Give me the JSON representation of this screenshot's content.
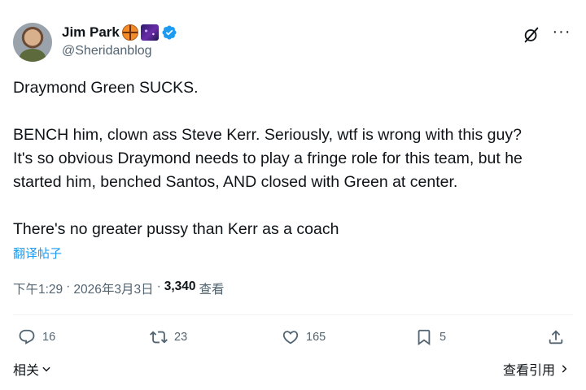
{
  "author": {
    "display_name": "Jim Park",
    "handle": "@Sheridanblog",
    "badges": [
      "basketball-emoji",
      "galaxy-emoji",
      "verified-badge"
    ]
  },
  "tweet": {
    "lines": [
      "Draymond Green SUCKS.",
      "",
      "BENCH him, clown ass Steve Kerr. Seriously, wtf is wrong with this guy?",
      "It's so obvious Draymond needs to play a fringe role for this team, but he",
      "started him, benched Santos, AND closed with Green at center.",
      "",
      "There's no greater pussy than Kerr as a coach"
    ],
    "translate_label": "翻译帖子"
  },
  "meta": {
    "time": "下午1:29",
    "sep1": "·",
    "date": "2026年3月3日",
    "sep2": "·",
    "views_count": "3,340",
    "views_label": "查看"
  },
  "actions": {
    "replies": "16",
    "reposts": "23",
    "likes": "165",
    "bookmarks": "5"
  },
  "footer": {
    "related_label": "相关",
    "quotes_label": "查看引用"
  },
  "colors": {
    "text": "#0f1419",
    "secondary": "#536471",
    "link": "#1d9bf0",
    "verified": "#1d9bf0",
    "divider": "#eff3f4"
  }
}
